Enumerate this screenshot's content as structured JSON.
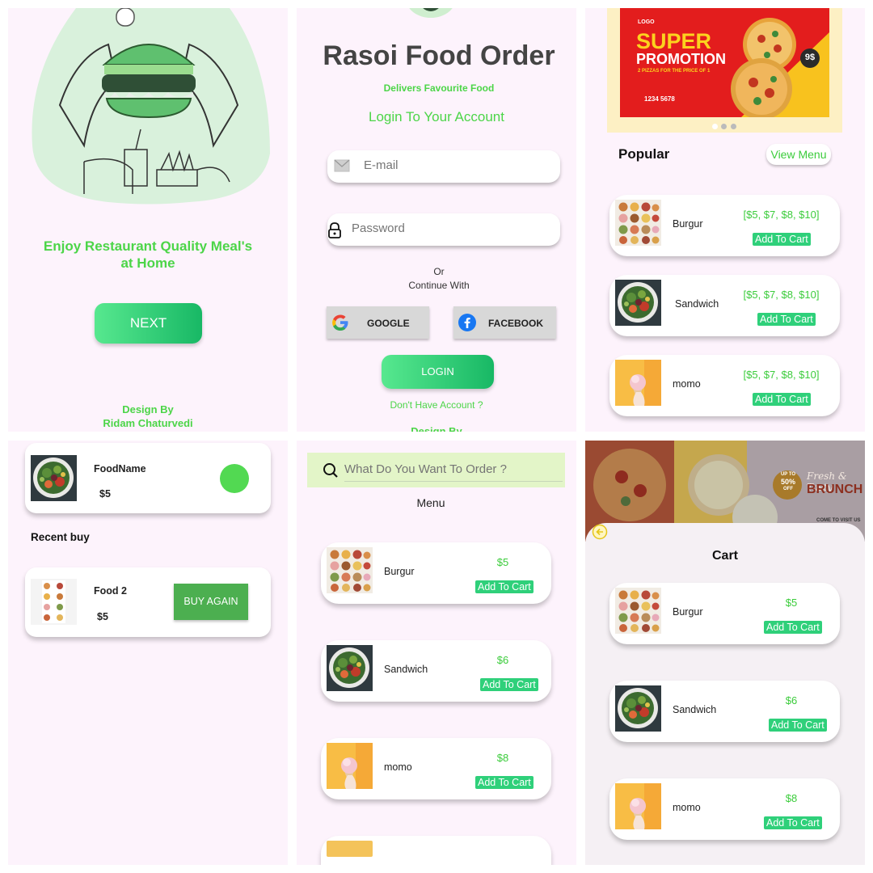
{
  "welcome": {
    "tagline": "Enjoy Restaurant Quality Meal's at Home",
    "next_label": "NEXT",
    "credit_line1": "Design By",
    "credit_line2": "Ridam Chaturvedi"
  },
  "login": {
    "title": "Rasoi Food Order",
    "subtitle": "Delivers Favourite Food",
    "heading": "Login To Your Account",
    "email_placeholder": "E-mail",
    "password_placeholder": "Password",
    "or_text": "Or",
    "continue_text": "Continue With",
    "google_label": "GOOGLE",
    "facebook_label": "FACEBOOK",
    "login_label": "LOGIN",
    "no_account": "Don't  Have Account ?",
    "credit": "Design By"
  },
  "home": {
    "banner": {
      "logo": "LOGO",
      "line1": "SUPER",
      "line2": "PROMOTION",
      "offer": "2 PIZZAS FOR THE PRICE OF 1",
      "phone": "1234 5678",
      "price_tag": "9$"
    },
    "popular_label": "Popular",
    "view_menu_label": "View Menu",
    "items": [
      {
        "name": "Burgur",
        "price": "[$5, $7, $8, $10]",
        "button": "Add To Cart"
      },
      {
        "name": "Sandwich",
        "price": "[$5, $7, $8, $10]",
        "button": "Add To Cart"
      },
      {
        "name": "momo",
        "price": "[$5, $7, $8, $10]",
        "button": "Add To Cart"
      }
    ]
  },
  "profile": {
    "food_name": "FoodName",
    "food_price": "$5",
    "recent_label": "Recent buy",
    "recent_name": "Food 2",
    "recent_price": "$5",
    "buy_again_label": "BUY AGAIN"
  },
  "menu": {
    "search_placeholder": "What Do You Want To Order ?",
    "title": "Menu",
    "items": [
      {
        "name": "Burgur",
        "price": "$5",
        "button": "Add To Cart"
      },
      {
        "name": "Sandwich",
        "price": "$6",
        "button": "Add To Cart"
      },
      {
        "name": "momo",
        "price": "$8",
        "button": "Add To Cart"
      }
    ]
  },
  "cart": {
    "banner_text1": "Fresh & Tasty",
    "banner_text2": "BRUNCH",
    "banner_badge1": "UP TO",
    "banner_badge2": "50%",
    "banner_badge3": "OFF",
    "banner_footer": "COME TO VISIT US",
    "title": "Cart",
    "items": [
      {
        "name": "Burgur",
        "price": "$5",
        "button": "Add To Cart"
      },
      {
        "name": "Sandwich",
        "price": "$6",
        "button": "Add To Cart"
      },
      {
        "name": "momo",
        "price": "$8",
        "button": "Add To Cart"
      }
    ]
  },
  "colors": {
    "accent_green": "#4cd548",
    "button_green": "#2fd07a",
    "panel_bg": "#fdf3fc"
  }
}
